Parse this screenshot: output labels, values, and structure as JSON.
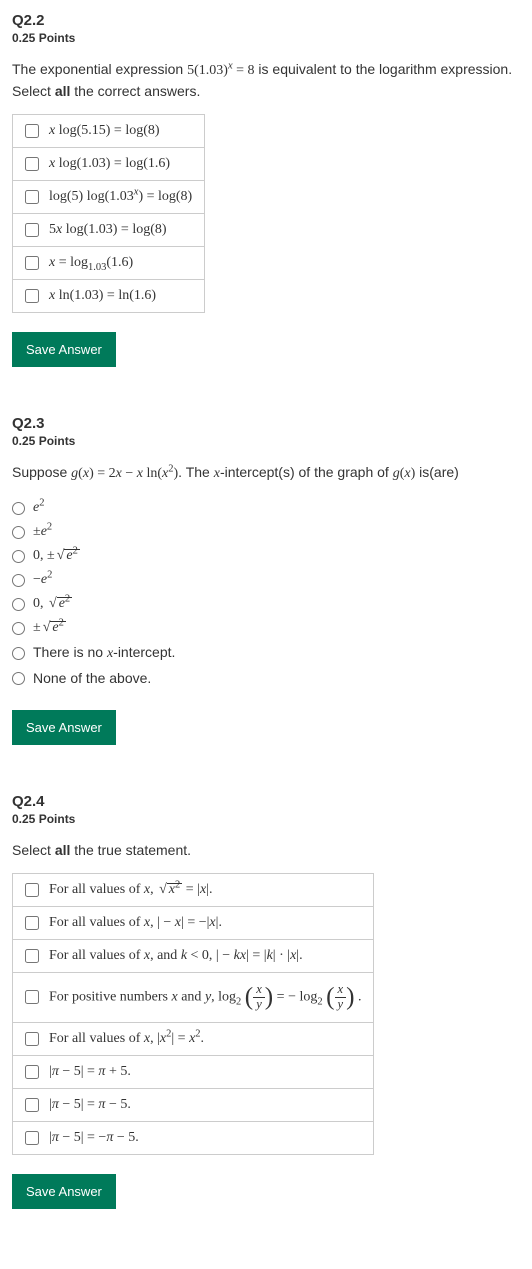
{
  "q22": {
    "title": "Q2.2",
    "points": "0.25 Points",
    "stem_pre": "The exponential expression ",
    "stem_math": "5(1.03)^x = 8",
    "stem_post": " is equivalent to the logarithm expression. Select ",
    "stem_bold": "all",
    "stem_end": " the correct answers.",
    "choices": [
      "x log(5.15) = log(8)",
      "x log(1.03) = log(1.6)",
      "log(5) log(1.03^x) = log(8)",
      "5x log(1.03) = log(8)",
      "x = log_{1.03}(1.6)",
      "x ln(1.03) = ln(1.6)"
    ],
    "save": "Save Answer"
  },
  "q23": {
    "title": "Q2.3",
    "points": "0.25 Points",
    "stem_pre": "Suppose ",
    "stem_math": "g(x) = 2x − x ln(x^2)",
    "stem_mid": ". The ",
    "stem_xint": "x-intercept(s)",
    "stem_post": " of the graph of ",
    "stem_gx": "g(x)",
    "stem_end": " is(are)",
    "choices": [
      "e^2",
      "±e^2",
      "0, ±√(e^2)",
      "−e^2",
      "0, √(e^2)",
      "±√(e^2)",
      "There is no x-intercept.",
      "None of the above."
    ],
    "save": "Save Answer"
  },
  "q24": {
    "title": "Q2.4",
    "points": "0.25 Points",
    "stem_pre": "Select ",
    "stem_bold": "all",
    "stem_post": " the true statement.",
    "choices": [
      "For all values of x, √(x^2) = |x|.",
      "For all values of x, |−x| = −|x|.",
      "For all values of x, and k < 0, |−kx| = |k| · |x|.",
      "For positive numbers x and y, log_2(x/y) = −log_2(x/y).",
      "For all values of x, |x^2| = x^2.",
      "|π − 5| = π + 5.",
      "|π − 5| = π − 5.",
      "|π − 5| = −π − 5."
    ],
    "save": "Save Answer"
  }
}
